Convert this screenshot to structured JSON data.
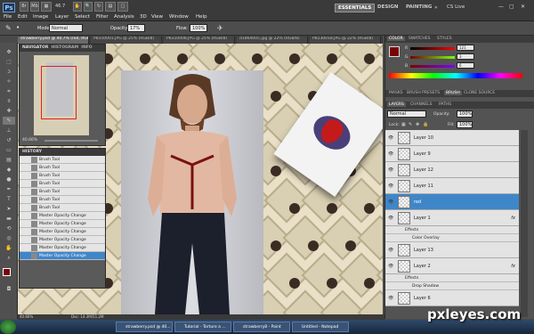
{
  "app": {
    "logo": "Ps",
    "zoom": "46.7",
    "cslive": "CS Live"
  },
  "menu": [
    "File",
    "Edit",
    "Image",
    "Layer",
    "Select",
    "Filter",
    "Analysis",
    "3D",
    "View",
    "Window",
    "Help"
  ],
  "workspaces": [
    "ESSENTIALS",
    "DESIGN",
    "PAINTING"
  ],
  "options": {
    "mode_label": "Mode:",
    "mode_value": "Normal",
    "opacity_label": "Opacity:",
    "opacity_value": "17%",
    "flow_label": "Flow:",
    "flow_value": "100%"
  },
  "doc_tabs": [
    "strawberry.psd @ 40.7% (red, RGB/8)",
    "P8310001.JPG @ 25% (RGB/8)",
    "P8310008.JPG @ 25% (RGB/8)",
    "d1864005.jpg @ 22% (RGB/8)",
    "P8130018.JPG @ 22% (RGB/8)"
  ],
  "navigator": {
    "tabs": [
      "NAVIGATOR",
      "HISTOGRAM",
      "INFO"
    ],
    "zoom": "40.66%"
  },
  "history": {
    "title": "HISTORY",
    "items": [
      "Brush Tool",
      "Brush Tool",
      "Brush Tool",
      "Brush Tool",
      "Brush Tool",
      "Brush Tool",
      "Brush Tool",
      "Master Opacity Change",
      "Master Opacity Change",
      "Master Opacity Change",
      "Master Opacity Change",
      "Master Opacity Change",
      "Master Opacity Change"
    ]
  },
  "color_panel": {
    "tabs": [
      "COLOR",
      "SWATCHES",
      "STYLES"
    ],
    "r": "121",
    "g": "3",
    "b": "6",
    "fg": "#790306"
  },
  "adj_tabs": [
    "MASKS",
    "BRUSH PRESETS",
    "BRUSH",
    "CLONE SOURCE"
  ],
  "layers_panel": {
    "tabs": [
      "LAYERS",
      "CHANNELS",
      "PATHS"
    ],
    "blend": "Normal",
    "opacity_label": "Opacity:",
    "opacity_value": "100%",
    "lock_label": "Lock:",
    "fill_label": "Fill:",
    "fill_value": "100%",
    "layers": [
      "Layer 10",
      "Layer 9",
      "Layer 12",
      "Layer 11",
      "red",
      "Layer 1",
      "Layer 13",
      "Layer 2",
      "Layer 6"
    ],
    "effects": "Effects",
    "color_overlay": "Color Overlay",
    "drop_shadow": "Drop Shadow",
    "fx": "fx"
  },
  "status": {
    "zoom": "40.66%",
    "doc": "Doc: 14.3M/51.2M"
  },
  "taskbar": [
    "strawberry.psd @ 40...",
    "Tutorial - Torture a ...",
    "strawberry8 - Paint",
    "Untitled - Notepad"
  ],
  "watermark": "pxleyes.com"
}
